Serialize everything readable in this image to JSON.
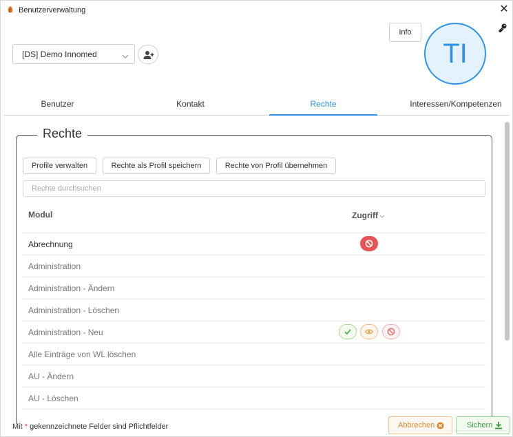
{
  "window": {
    "title": "Benutzerverwaltung"
  },
  "header": {
    "company_select": "[DS] Demo Innomed",
    "info_label": "Info",
    "avatar_initials": "TI"
  },
  "tabs": [
    {
      "label": "Benutzer",
      "active": false
    },
    {
      "label": "Kontakt",
      "active": false
    },
    {
      "label": "Rechte",
      "active": true
    },
    {
      "label": "Interessen/Kompetenzen",
      "active": false
    }
  ],
  "rights": {
    "legend": "Rechte",
    "buttons": {
      "manage_profiles": "Profile verwalten",
      "save_as_profile": "Rechte als Profil speichern",
      "apply_from_profile": "Rechte von Profil übernehmen"
    },
    "search_placeholder": "Rechte durchsuchen",
    "columns": {
      "module": "Modul",
      "access": "Zugriff"
    },
    "rows": [
      {
        "module": "Abrechnung",
        "access": "deny"
      },
      {
        "module": "Administration",
        "access": ""
      },
      {
        "module": "Administration - Ändern",
        "access": ""
      },
      {
        "module": "Administration - Löschen",
        "access": ""
      },
      {
        "module": "Administration - Neu",
        "access": "choice"
      },
      {
        "module": "Alle Einträge von WL löschen",
        "access": ""
      },
      {
        "module": "AU - Ändern",
        "access": ""
      },
      {
        "module": "AU - Löschen",
        "access": ""
      }
    ]
  },
  "footer": {
    "note_prefix": "Mit",
    "note_star": "*",
    "note_suffix": "gekennzeichnete Felder sind Pflichtfelder",
    "cancel_label": "Abbrechen",
    "save_label": "Sichern"
  },
  "colors": {
    "accent": "#2f94e8",
    "deny": "#e85454",
    "allow": "#5cb85c",
    "read": "#e6a14a"
  }
}
